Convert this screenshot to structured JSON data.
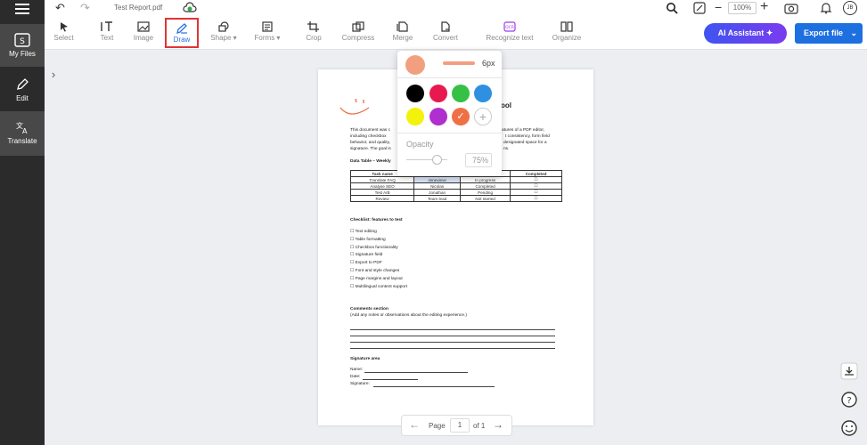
{
  "app": {
    "file_name": "Test Report.pdf",
    "zoom": "100%",
    "user_initials": "JB"
  },
  "sidebar": {
    "items": [
      {
        "label": "My Files"
      },
      {
        "label": "Edit"
      },
      {
        "label": "Translate"
      }
    ]
  },
  "toolbar": {
    "tools": [
      "Select",
      "Text",
      "Image",
      "Draw",
      "Shape",
      "Forms",
      "Crop",
      "Compress",
      "Merge",
      "Convert",
      "Recognize text",
      "Organize"
    ],
    "ai_label": "AI Assistant",
    "export_label": "Export file"
  },
  "draw_popup": {
    "stroke_width": "6px",
    "opacity_label": "Opacity",
    "opacity_value": "75%",
    "selected_color": "#f08a5d",
    "colors": [
      "#000000",
      "#e8194f",
      "#35c046",
      "#2f8fe0",
      "#f2f20a",
      "#b02fcf",
      "#f07045"
    ]
  },
  "document": {
    "title_tail": "ool",
    "intro_lines": [
      "This document was c",
      "including checkbox",
      "behavior, and quality,",
      "signature. The goal is"
    ],
    "intro_right": [
      "atures of a PDF editor,",
      "t consistency, form field",
      "designated space for a",
      "ns."
    ],
    "table_title": "Data Table – Weekly",
    "table_headers": [
      "Task name",
      "",
      "",
      "Completed"
    ],
    "table_rows": [
      [
        "Translate FAQ",
        "Jenevieve",
        "In progress",
        ""
      ],
      [
        "Analyse SEO",
        "Nicolas",
        "Completed",
        ""
      ],
      [
        "Test A/B",
        "Jonathan",
        "Pending",
        ""
      ],
      [
        "Review",
        "Team lead",
        "Not started",
        ""
      ]
    ],
    "checklist_title": "Checklist: features to test",
    "checklist": [
      "Text editing",
      "Table formatting",
      "Checkbox functionality",
      "Signature field",
      "Export to PDF",
      "Font and style changes",
      "Page margins and layout",
      "Multilingual content support"
    ],
    "comments_title": "Comments section",
    "comments_sub": "(Add any notes or observations about the editing experience.)",
    "signature_title": "Signature area",
    "sig_name": "Name:",
    "sig_date": "Date:",
    "sig_signature": "Signature:"
  },
  "pager": {
    "label": "Page",
    "current": "1",
    "total": "of 1"
  }
}
